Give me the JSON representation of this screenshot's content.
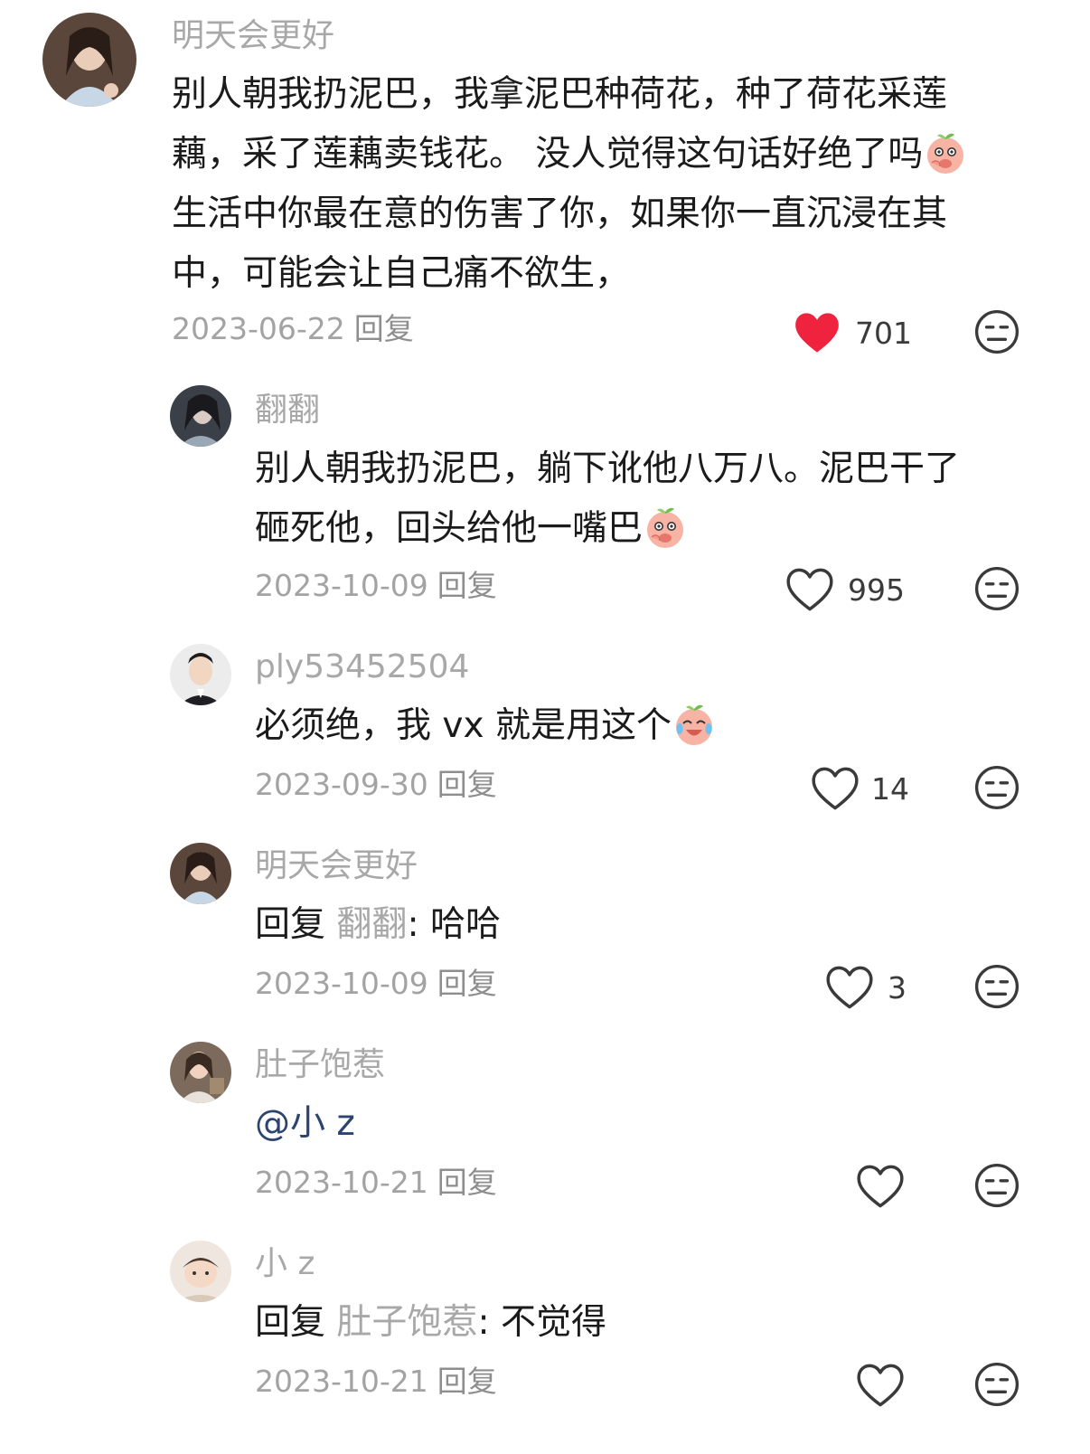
{
  "comments": [
    {
      "username": "明天会更好",
      "lines": [
        "别人朝我扔泥巴，我拿泥巴种荷花，种了荷花采莲",
        "藕，采了莲藕卖钱花。 没人觉得这句话好绝了吗",
        "生活中你最在意的伤害了你，如果你一直沉浸在其",
        "中，可能会让自己痛不欲生，"
      ],
      "date": "2023-06-22",
      "reply_label": "回复",
      "likes": "701",
      "liked": true,
      "emoji": "peach-shy-emoji"
    },
    {
      "username": "翻翻",
      "lines": [
        "别人朝我扔泥巴，躺下讹他八万八。泥巴干了",
        "砸死他，回头给他一嘴巴"
      ],
      "date": "2023-10-09",
      "reply_label": "回复",
      "likes": "995",
      "liked": false,
      "emoji": "peach-shy-emoji"
    },
    {
      "username": "ply53452504",
      "lines": [
        "必须绝，我 vx 就是用这个"
      ],
      "date": "2023-09-30",
      "reply_label": "回复",
      "likes": "14",
      "liked": false,
      "emoji": "peach-laugh-cry-emoji"
    },
    {
      "username": "明天会更好",
      "reply_prefix": "回复",
      "reply_to": "翻翻",
      "text": ": 哈哈",
      "date": "2023-10-09",
      "reply_label": "回复",
      "likes": "3",
      "liked": false
    },
    {
      "username": "肚子饱惹",
      "mention": "@小 z",
      "date": "2023-10-21",
      "reply_label": "回复",
      "likes": "",
      "liked": false
    },
    {
      "username": "小 z",
      "reply_prefix": "回复",
      "reply_to": "肚子饱惹",
      "text": ": 不觉得",
      "date": "2023-10-21",
      "reply_label": "回复",
      "likes": "",
      "liked": false
    }
  ],
  "colors": {
    "liked_heart": "#f0233f",
    "username": "#a8a8a8",
    "mention": "#2d4470"
  },
  "icons": [
    "heart-icon",
    "dislike-face-icon"
  ]
}
